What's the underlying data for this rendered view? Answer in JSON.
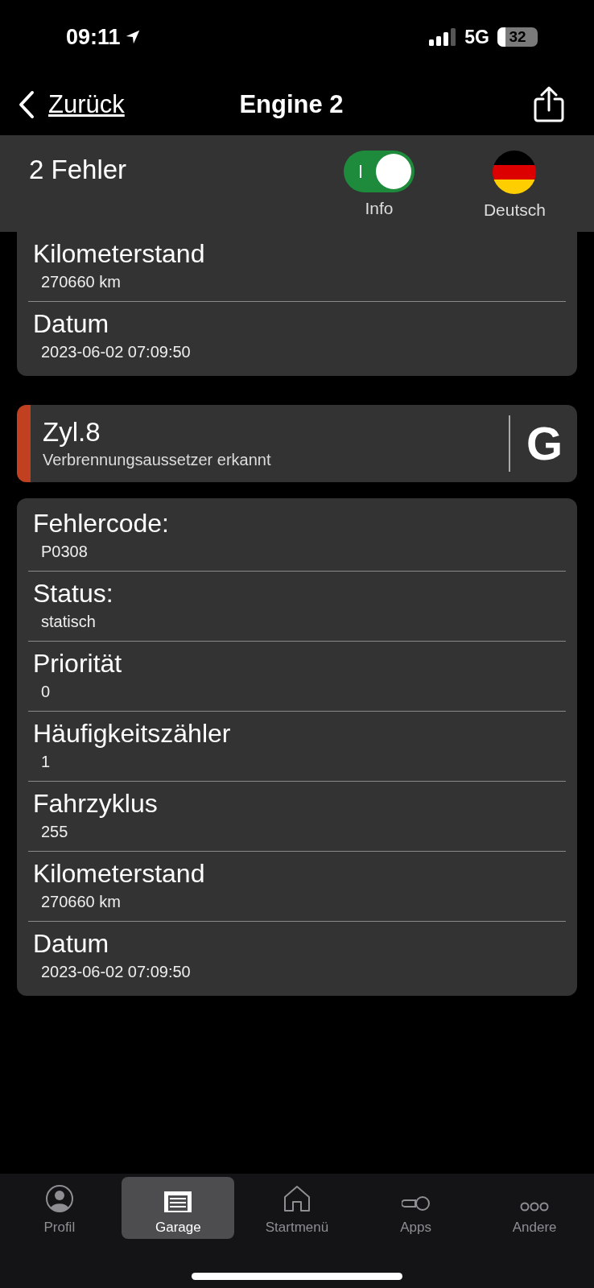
{
  "status_bar": {
    "time": "09:11",
    "network": "5G",
    "battery": "32"
  },
  "nav": {
    "back": "Zurück",
    "title": "Engine 2"
  },
  "header": {
    "count": "2 Fehler",
    "toggle": {
      "label": "Info",
      "on": true
    },
    "language": "Deutsch"
  },
  "previous_card": {
    "rows": [
      {
        "label": "Kilometerstand",
        "value": "270660 km"
      },
      {
        "label": "Datum",
        "value": "2023-06-02 07:09:50"
      }
    ]
  },
  "error": {
    "title": "Zyl.8",
    "description": "Verbrennungsaussetzer erkannt",
    "color": "#c0401f",
    "translate": "G"
  },
  "details": {
    "rows": [
      {
        "label": "Fehlercode:",
        "value": "P0308"
      },
      {
        "label": "Status:",
        "value": "statisch"
      },
      {
        "label": "Priorität",
        "value": "0"
      },
      {
        "label": "Häufigkeitszähler",
        "value": "1"
      },
      {
        "label": "Fahrzyklus",
        "value": "255"
      },
      {
        "label": "Kilometerstand",
        "value": "270660 km"
      },
      {
        "label": "Datum",
        "value": "2023-06-02 07:09:50"
      }
    ]
  },
  "tabs": [
    {
      "label": "Profil",
      "kind": "profile",
      "selected": false
    },
    {
      "label": "Garage",
      "kind": "garage",
      "selected": true
    },
    {
      "label": "Startmenü",
      "kind": "home",
      "selected": false
    },
    {
      "label": "Apps",
      "kind": "apps",
      "selected": false
    },
    {
      "label": "Andere",
      "kind": "more",
      "selected": false
    }
  ]
}
